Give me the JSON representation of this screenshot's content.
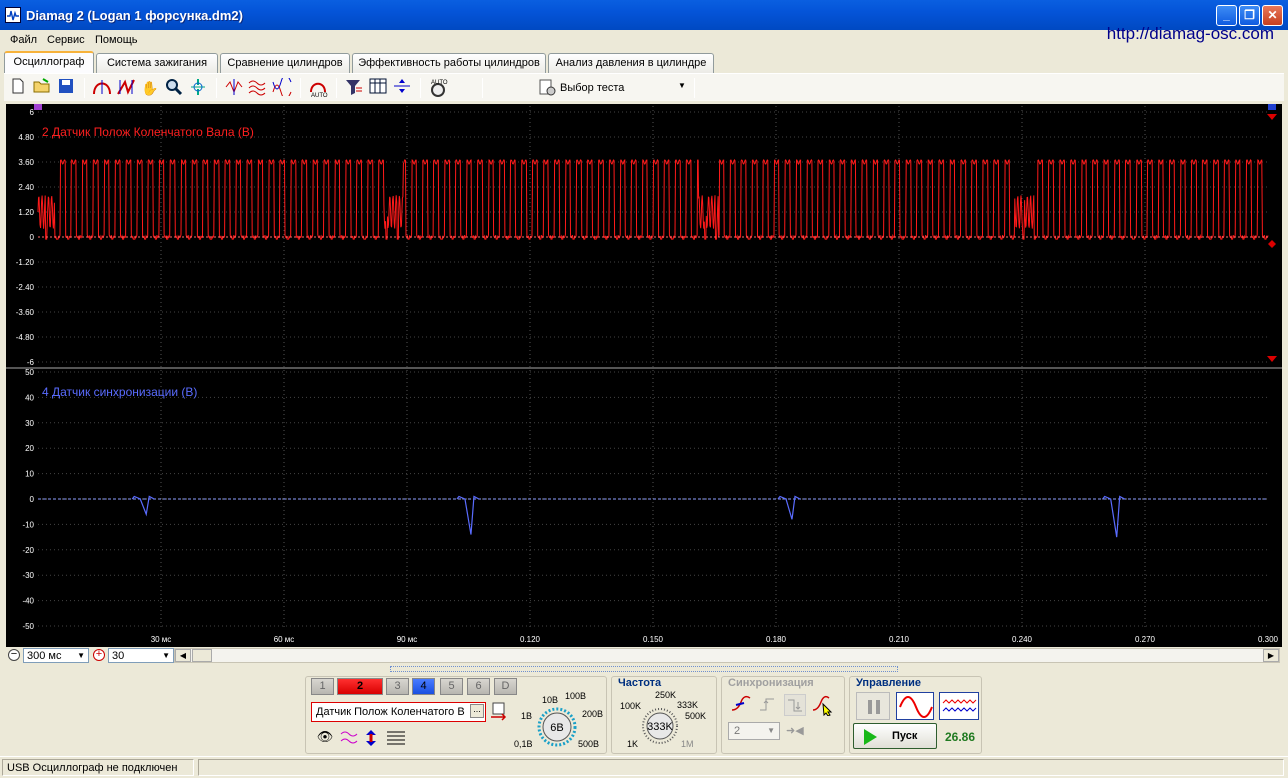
{
  "window": {
    "title": "Diamag 2 (Logan 1 форсунка.dm2)",
    "url": "http://diamag-osc.com"
  },
  "menu": [
    "Файл",
    "Сервис",
    "Помощь"
  ],
  "tabs": [
    "Осциллограф",
    "Система зажигания",
    "Сравнение цилиндров",
    "Эффективность работы цилиндров",
    "Анализ давления в цилиндре"
  ],
  "toolbar": {
    "test_select": "Выбор теста"
  },
  "channels": [
    {
      "label": "2 Датчик Полож Коленчатого Вала (В)",
      "color": "#ff2020",
      "yticks": [
        "6",
        "4.80",
        "3.60",
        "2.40",
        "1.20",
        "0",
        "-1.20",
        "-2.40",
        "-3.60",
        "-4.80",
        "-6"
      ]
    },
    {
      "label": "4 Датчик синхронизации (В)",
      "color": "#5a6cff",
      "yticks": [
        "50",
        "40",
        "30",
        "20",
        "10",
        "0",
        "-10",
        "-20",
        "-30",
        "-40",
        "-50"
      ]
    }
  ],
  "xticks": [
    "30 мс",
    "60 мс",
    "90 мс",
    "0.120",
    "0.150",
    "0.180",
    "0.210",
    "0.240",
    "0.270",
    "0.300"
  ],
  "timebase": "300 мс",
  "zoom": "30",
  "channel_buttons": [
    "1",
    "2",
    "3",
    "4",
    "5",
    "6",
    "D"
  ],
  "sensor": {
    "name": "Датчик Полож Коленчатого В",
    "dots": "..."
  },
  "volt_knob": {
    "value": "6В",
    "labels": [
      "10В",
      "100В",
      "200В",
      "500В",
      "0,1В",
      "1В"
    ]
  },
  "freq": {
    "title": "Частота",
    "value": "333K",
    "labels": [
      "250K",
      "100K",
      "333K",
      "500K",
      "1K",
      "1M"
    ]
  },
  "sync": {
    "title": "Синхронизация",
    "value": "2"
  },
  "control": {
    "title": "Управление",
    "start": "Пуск",
    "reading": "26.86"
  },
  "status": {
    "text": "USB Осциллограф не подключен"
  }
}
